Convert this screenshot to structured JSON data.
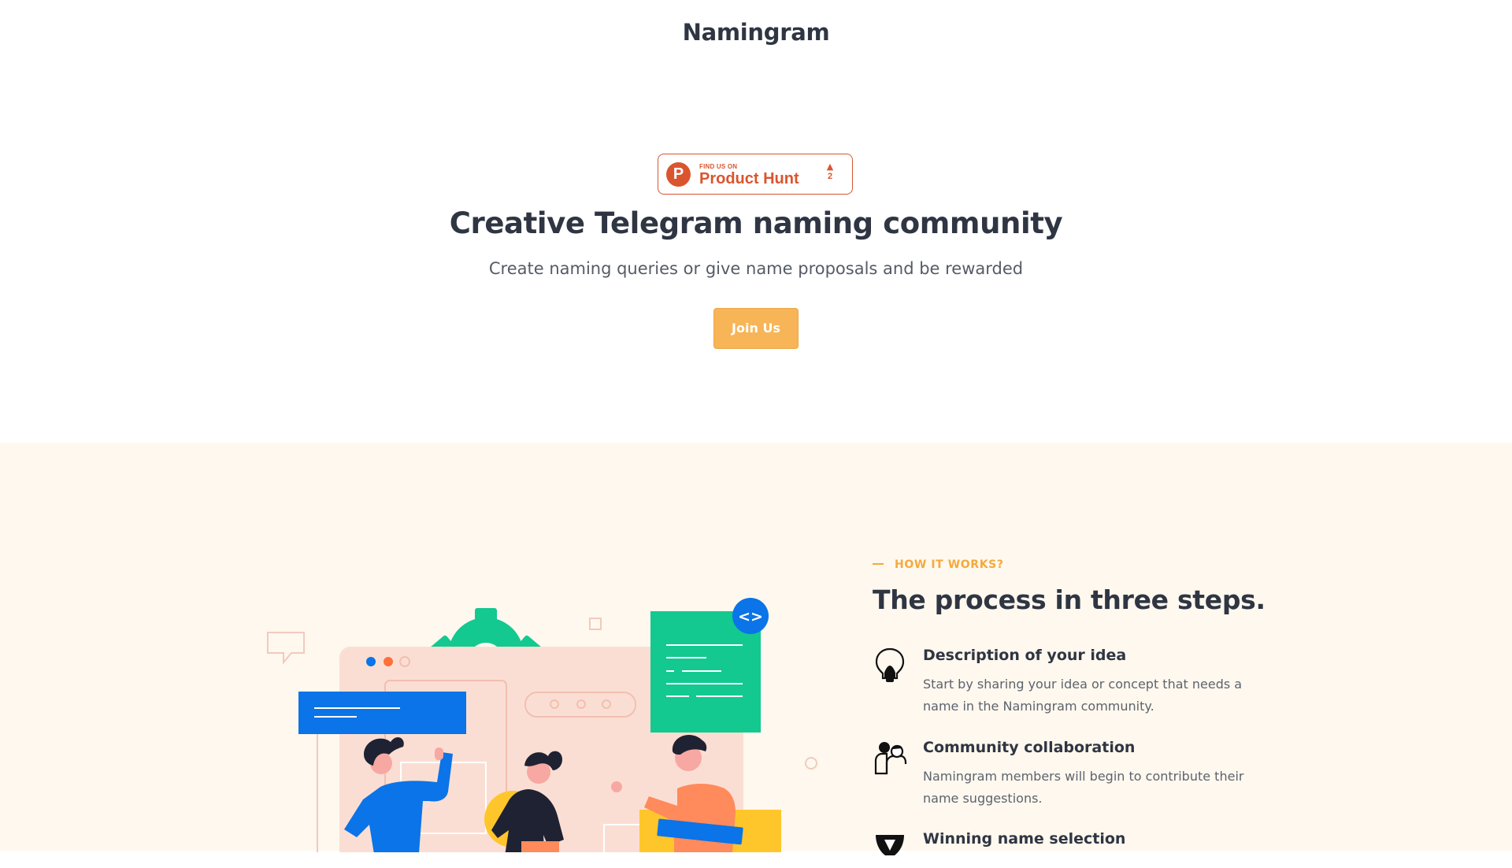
{
  "header": {
    "brand": "Namingram"
  },
  "product_hunt": {
    "small_text": "FIND US ON",
    "big_text": "Product Hunt",
    "logo_letter": "P",
    "upvote_icon": "triangle-up-icon",
    "votes": "2"
  },
  "hero": {
    "title": "Creative Telegram naming community",
    "subtitle": "Create naming queries or give name proposals and be rewarded",
    "cta_label": "Join Us"
  },
  "how_it_works": {
    "eyebrow": "HOW IT WORKS?",
    "title": "The process in three steps.",
    "steps": [
      {
        "icon": "lightbulb-icon",
        "title": "Description of your idea",
        "description": "Start by sharing your idea or concept that needs a name in the Namingram community."
      },
      {
        "icon": "community-icon",
        "title": "Community collaboration",
        "description": "Namingram members will begin to contribute their name suggestions."
      },
      {
        "icon": "trophy-icon",
        "title": "Winning name selection",
        "description": ""
      }
    ]
  },
  "illustration": {
    "code_badge": "<>"
  },
  "colors": {
    "accent": "#f7b557",
    "heading": "#2f3542",
    "section_bg": "#fef8ee",
    "product_hunt": "#da552f",
    "blue": "#0a74e8",
    "green": "#13c98f",
    "yellow": "#ffc62b",
    "orange": "#ff8a5b"
  }
}
